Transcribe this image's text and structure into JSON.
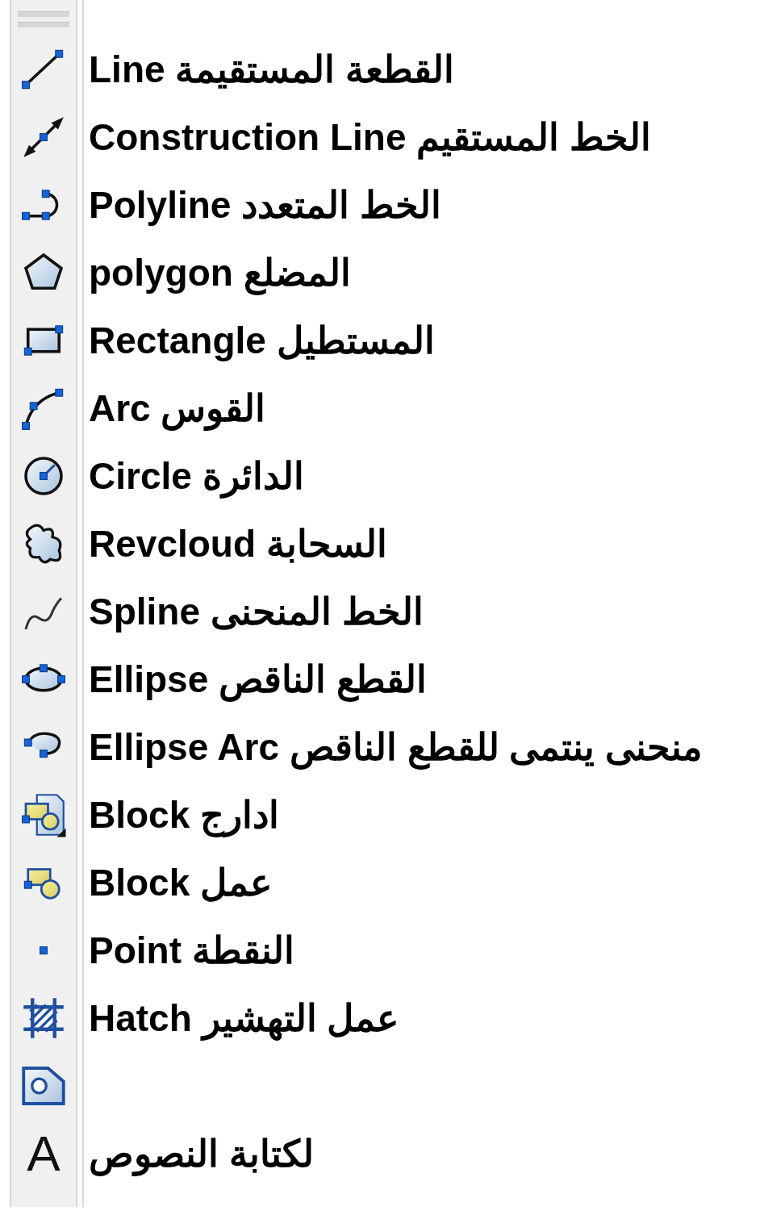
{
  "toolbar": {
    "tools": [
      {
        "kind": "line",
        "label": "Line القطعة المستقيمة"
      },
      {
        "kind": "xline",
        "label": "Construction Line الخط المستقيم"
      },
      {
        "kind": "polyline",
        "label": "Polyline الخط المتعدد"
      },
      {
        "kind": "polygon",
        "label": "polygon المضلع"
      },
      {
        "kind": "rectangle",
        "label": "Rectangle المستطيل"
      },
      {
        "kind": "arc",
        "label": "Arc القوس"
      },
      {
        "kind": "circle",
        "label": "Circle الدائرة"
      },
      {
        "kind": "revcloud",
        "label": "Revcloud السحابة"
      },
      {
        "kind": "spline",
        "label": "Spline الخط المنحنى"
      },
      {
        "kind": "ellipse",
        "label": "Ellipse القطع الناقص"
      },
      {
        "kind": "ellipse_arc",
        "label": "Ellipse Arc منحنى ينتمى للقطع الناقص"
      },
      {
        "kind": "insert_block",
        "label": "Block ادارج"
      },
      {
        "kind": "make_block",
        "label": "Block عمل"
      },
      {
        "kind": "point",
        "label": "Point النقطة"
      },
      {
        "kind": "hatch",
        "label": "Hatch عمل التهشير"
      },
      {
        "kind": "region"
      },
      {
        "kind": "text",
        "glyph": "A",
        "label": "لكتابة النصوص"
      }
    ]
  }
}
